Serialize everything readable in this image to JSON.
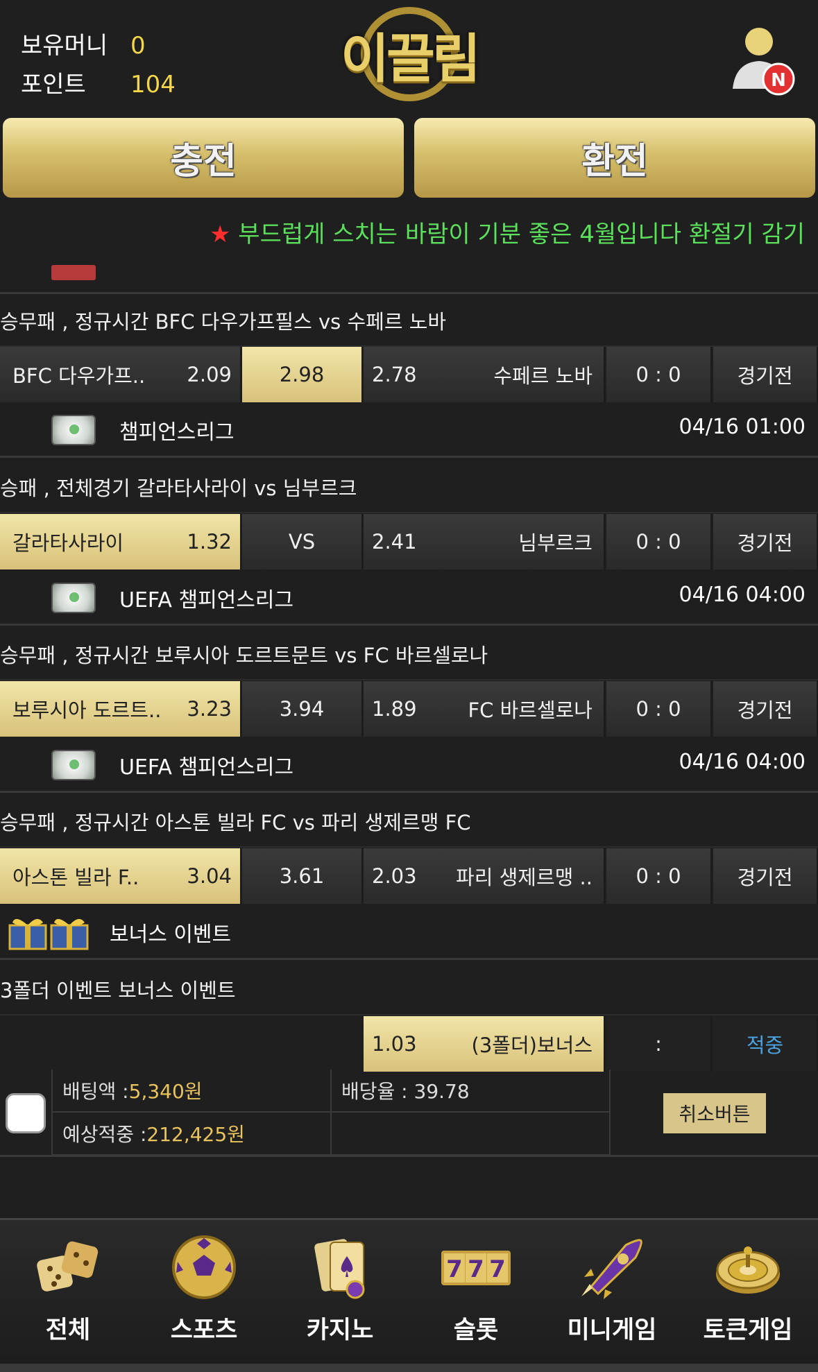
{
  "header": {
    "money_label": "보유머니",
    "money_value": "0",
    "points_label": "포인트",
    "points_value": "104",
    "logo_text": "이끌림",
    "notification_badge": "N",
    "charge_label": "충전",
    "exchange_label": "환전"
  },
  "ticker": {
    "star": "★",
    "text": "부드럽게 스치는 바람이 기분 좋은 4월입니다 환절기 감기"
  },
  "matches": [
    {
      "title": "승무패 , 정규시간 BFC 다우가프필스  vs  수페르 노바",
      "home": "BFC 다우가프..",
      "home_odds": "2.09",
      "draw": "2.98",
      "away_odds": "2.78",
      "away": "수페르 노바",
      "score": "0 : 0",
      "status": "경기전",
      "selected": "draw",
      "league": "챔피언스리그",
      "time": "04/16 01:00"
    },
    {
      "title": "승패 , 전체경기 갈라타사라이  vs  님부르크",
      "home": "갈라타사라이",
      "home_odds": "1.32",
      "draw": "VS",
      "away_odds": "2.41",
      "away": "님부르크",
      "score": "0 : 0",
      "status": "경기전",
      "selected": "home",
      "league": "UEFA 챔피언스리그",
      "time": "04/16 04:00"
    },
    {
      "title": "승무패 , 정규시간 보루시아 도르트문트  vs  FC 바르셀로나",
      "home": "보루시아 도르트..",
      "home_odds": "3.23",
      "draw": "3.94",
      "away_odds": "1.89",
      "away": "FC 바르셀로나",
      "score": "0 : 0",
      "status": "경기전",
      "selected": "home",
      "league": "UEFA 챔피언스리그",
      "time": "04/16 04:00"
    },
    {
      "title": "승무패 , 정규시간 아스톤 빌라 FC  vs  파리 생제르맹 FC",
      "home": "아스톤 빌라 F..",
      "home_odds": "3.04",
      "draw": "3.61",
      "away_odds": "2.03",
      "away": "파리 생제르맹 ..",
      "score": "0 : 0",
      "status": "경기전",
      "selected": "home"
    }
  ],
  "bonus": {
    "section_label": "보너스 이벤트",
    "title": "3폴더 이벤트 보너스 이벤트",
    "odds": "1.03",
    "name": "(3폴더)보너스",
    "score": ":",
    "status": "적중"
  },
  "bet": {
    "amount_label": "배팅액 : ",
    "amount_value": "5,340원",
    "rate_label": "배당율 : 39.78",
    "expected_label": "예상적중 : ",
    "expected_value": "212,425원",
    "cancel_label": "취소버튼"
  },
  "nav": [
    {
      "label": "전체",
      "icon": "dice-icon"
    },
    {
      "label": "스포츠",
      "icon": "soccer-ball-icon"
    },
    {
      "label": "카지노",
      "icon": "playing-cards-icon"
    },
    {
      "label": "슬롯",
      "icon": "slot-777-icon"
    },
    {
      "label": "미니게임",
      "icon": "rocket-icon"
    },
    {
      "label": "토큰게임",
      "icon": "roulette-icon"
    }
  ],
  "colors": {
    "accent_gold": "#d8c27a",
    "ticker_green": "#5be05b",
    "value_yellow": "#f3d64a",
    "status_blue": "#4aa3df"
  }
}
